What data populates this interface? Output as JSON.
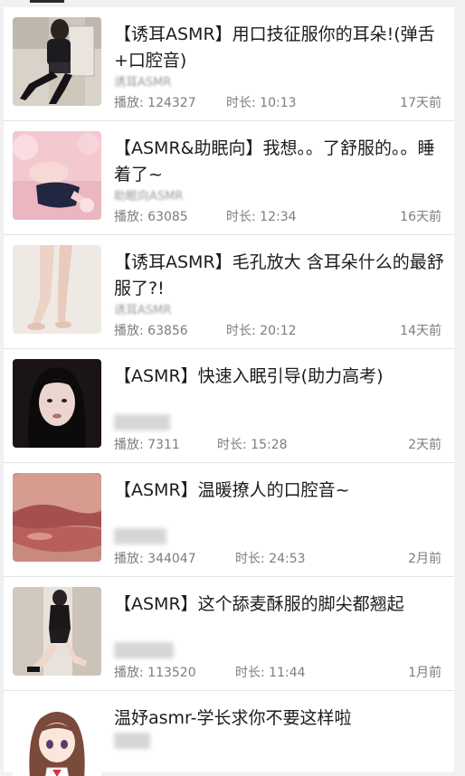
{
  "videos": [
    {
      "title": "【诱耳ASMR】用口技征服你的耳朵!(弹舌+口腔音)",
      "uploader": "诱耳ASMR",
      "plays": "播放: 124327",
      "duration": "时长: 10:13",
      "ago": "17天前",
      "thumb_icon": "woman-on-chair-photo"
    },
    {
      "title": "【ASMR&助眠向】我想。。了舒服的。。睡着了~",
      "uploader": "助眠向ASMR",
      "plays": "播放: 63085",
      "duration": "时长: 12:34",
      "ago": "16天前",
      "thumb_icon": "pink-bedroom-photo"
    },
    {
      "title": "【诱耳ASMR】毛孔放大 含耳朵什么的最舒服了?!",
      "uploader": "诱耳ASMR",
      "plays": "播放: 63856",
      "duration": "时长: 20:12",
      "ago": "14天前",
      "thumb_icon": "legs-photo"
    },
    {
      "title": "【ASMR】快速入眠引导(助力高考)",
      "uploader": "",
      "plays": "播放: 7311",
      "duration": "时长: 15:28",
      "ago": "2天前",
      "thumb_icon": "portrait-photo"
    },
    {
      "title": "【ASMR】温暖撩人的口腔音~",
      "uploader": "",
      "plays": "播放: 344047",
      "duration": "时长: 24:53",
      "ago": "2月前",
      "thumb_icon": "lips-closeup-photo"
    },
    {
      "title": "【ASMR】这个舔麦酥服的脚尖都翘起",
      "uploader": "",
      "plays": "播放: 113520",
      "duration": "时长: 11:44",
      "ago": "1月前",
      "thumb_icon": "kneeling-pose-photo"
    },
    {
      "title": "温妤asmr-学长求你不要这样啦",
      "uploader": "",
      "plays": "",
      "duration": "",
      "ago": "",
      "thumb_icon": "anime-girl-illustration"
    }
  ]
}
